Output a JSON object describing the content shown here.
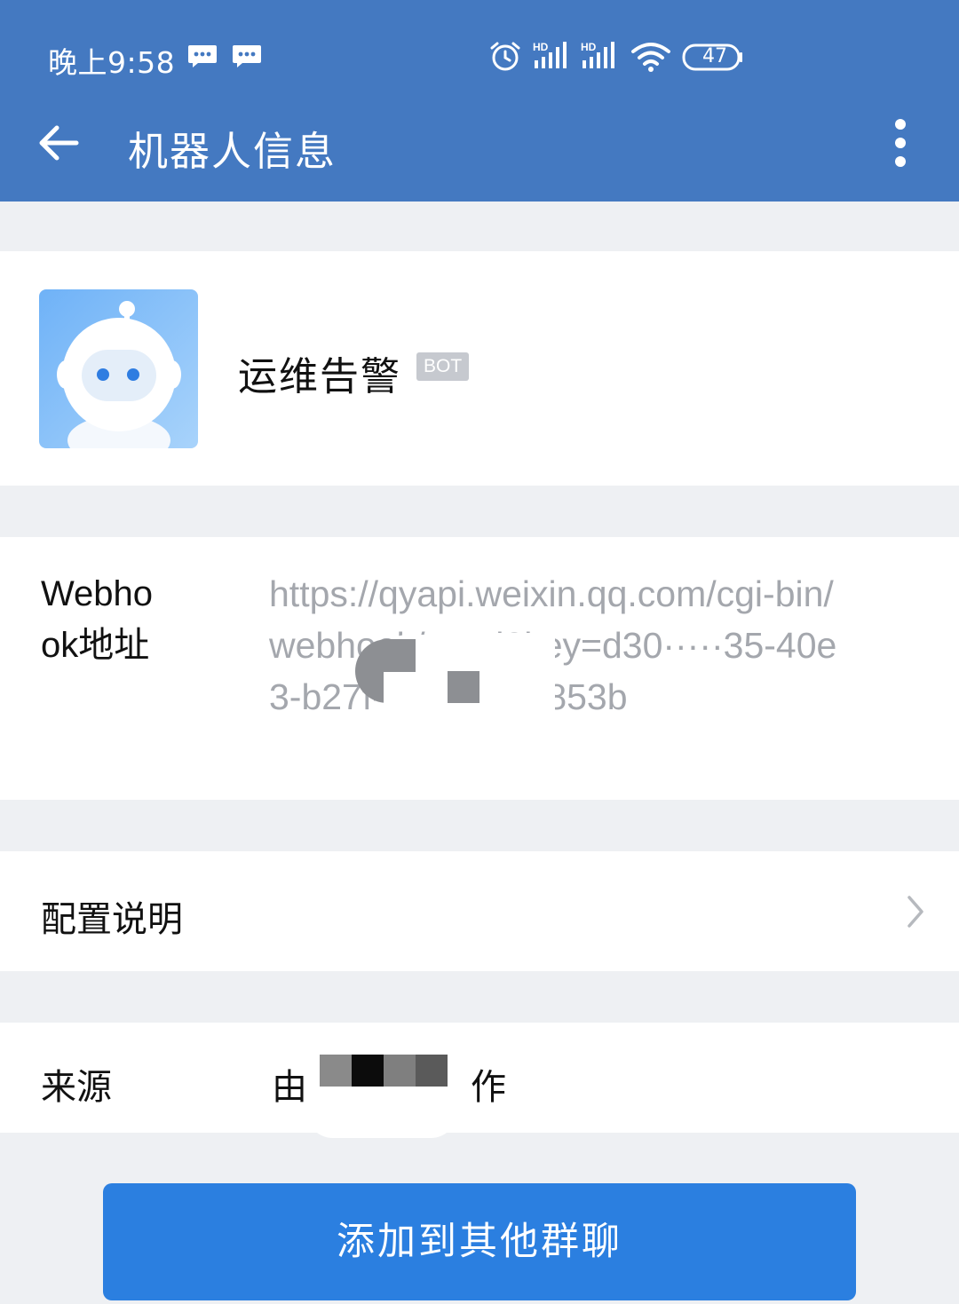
{
  "status_bar": {
    "time": "晚上9:58",
    "battery": "47",
    "icons": [
      "message-icon",
      "message-icon",
      "alarm-icon",
      "signal-hd-icon",
      "signal-hd-icon",
      "wifi-icon",
      "battery-icon"
    ]
  },
  "app_bar": {
    "title": "机器人信息",
    "back_icon": "arrow-left-icon",
    "more_icon": "more-vertical-icon"
  },
  "profile": {
    "name": "运维告警",
    "badge": "BOT",
    "avatar_icon": "robot-avatar-icon"
  },
  "webhook": {
    "label": "Webhook地址",
    "value": "https://qyapi.weixin.qq.com/cgi-bin/webhook/send?key=d30·····35-40e3-b27f-30417581853b"
  },
  "config": {
    "label": "配置说明",
    "chevron_icon": "chevron-right-icon"
  },
  "source": {
    "label": "来源",
    "prefix": "由",
    "suffix": "作"
  },
  "action": {
    "label": "添加到其他群聊"
  },
  "colors": {
    "app_bar": "#4479c1",
    "primary_button": "#2b7fe0",
    "page_background": "#eef0f3",
    "badge": "#c6c9cf",
    "muted_text": "#a4a7ad"
  }
}
